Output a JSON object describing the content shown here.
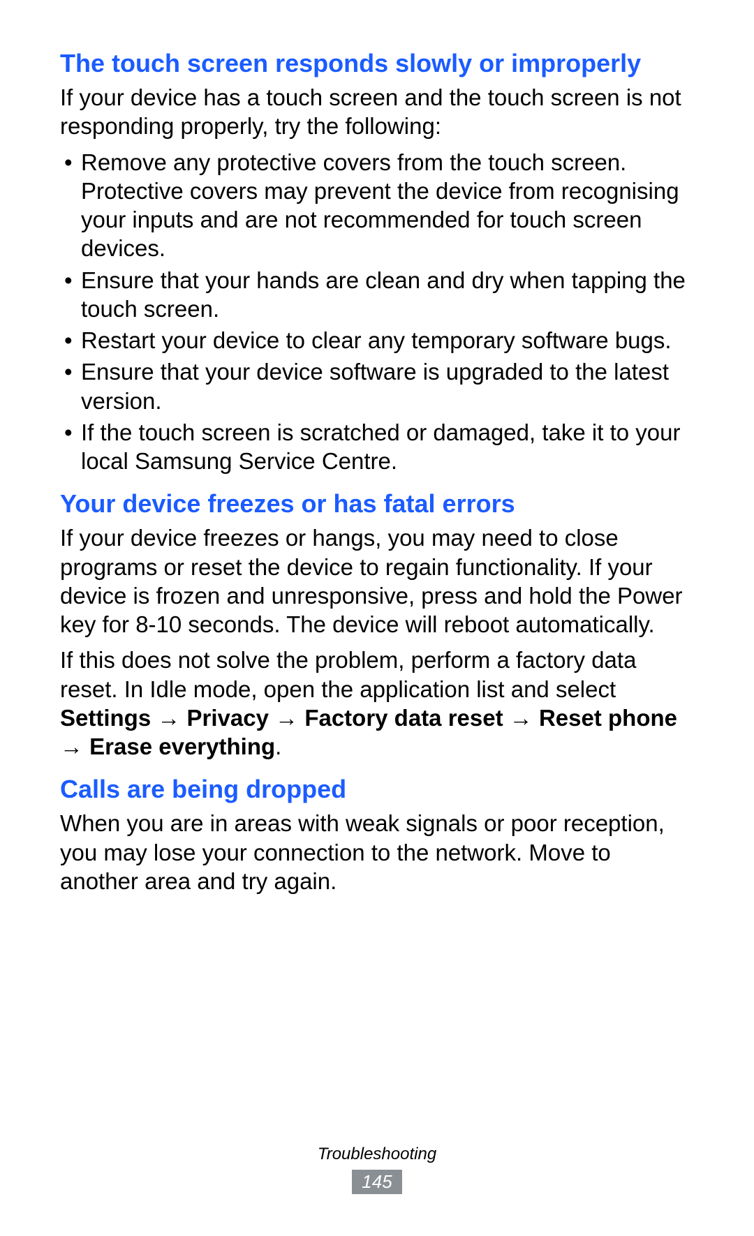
{
  "sections": [
    {
      "heading": "The touch screen responds slowly or improperly",
      "intro": "If your device has a touch screen and the touch screen is not responding properly, try the following:",
      "bullets": [
        "Remove any protective covers from the touch screen. Protective covers may prevent the device from recognising your inputs and are not recommended for touch screen devices.",
        "Ensure that your hands are clean and dry when tapping the touch screen.",
        "Restart your device to clear any temporary software bugs.",
        "Ensure that your device software is upgraded to the latest version.",
        "If the touch screen is scratched or damaged, take it to your local Samsung Service Centre."
      ]
    },
    {
      "heading": "Your device freezes or has fatal errors",
      "paragraphs": [
        "If your device freezes or hangs, you may need to close programs or reset the device to regain functionality. If your device is frozen and unresponsive, press and hold the Power key for 8-10 seconds. The device will reboot automatically."
      ],
      "path_intro": "If this does not solve the problem, perform a factory data reset. In Idle mode, open the application list and select ",
      "path_steps": [
        "Settings",
        "Privacy",
        "Factory data reset",
        "Reset phone",
        "Erase everything"
      ],
      "path_arrow": " → "
    },
    {
      "heading": "Calls are being dropped",
      "paragraphs": [
        "When you are in areas with weak signals or poor reception, you may lose your connection to the network. Move to another area and try again."
      ]
    }
  ],
  "footer": {
    "section_name": "Troubleshooting",
    "page_number": "145"
  }
}
